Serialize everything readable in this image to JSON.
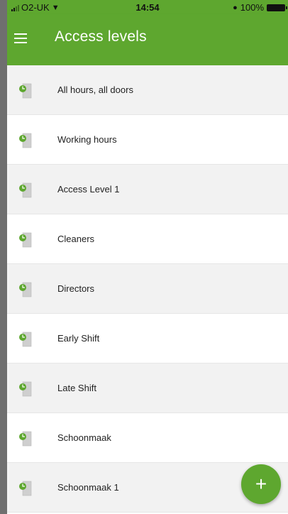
{
  "status_bar": {
    "carrier": "O2-UK",
    "time": "14:54",
    "battery": "100%"
  },
  "app_bar": {
    "title": "Access levels"
  },
  "access_levels": [
    {
      "label": "All hours, all doors"
    },
    {
      "label": "Working hours"
    },
    {
      "label": "Access Level 1"
    },
    {
      "label": "Cleaners"
    },
    {
      "label": "Directors"
    },
    {
      "label": "Early Shift"
    },
    {
      "label": "Late Shift"
    },
    {
      "label": "Schoonmaak"
    },
    {
      "label": "Schoonmaak 1"
    }
  ],
  "fab": {
    "label": "+"
  },
  "icons": {
    "menu": "menu-icon",
    "row": "door-clock-icon",
    "wifi": "wifi-icon",
    "alarm": "alarm-icon",
    "battery": "battery-icon"
  },
  "colors": {
    "brand_green": "#5ea72f",
    "row_alt_bg": "#f2f2f2",
    "door_gray": "#cfcfcf"
  }
}
